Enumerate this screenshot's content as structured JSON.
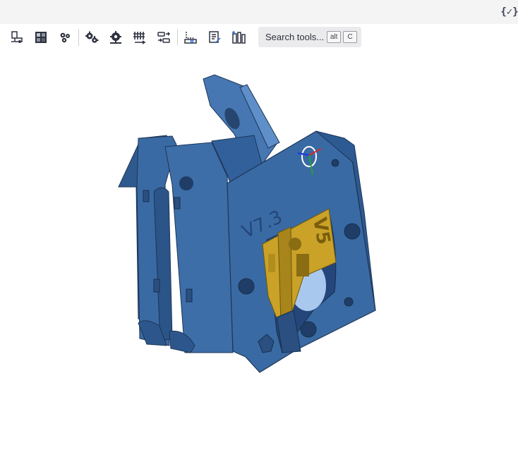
{
  "header": {
    "fullscreen_icon": "code-check-icon",
    "fullscreen_glyph": "{✓}"
  },
  "toolbar": {
    "tools": [
      {
        "name": "sketch-tool-icon"
      },
      {
        "name": "part-studio-tool-icon"
      },
      {
        "name": "assembly-tool-icon"
      },
      {
        "name": "gear-tool-icon"
      },
      {
        "name": "gear-settings-tool-icon"
      },
      {
        "name": "pattern-tool-icon"
      },
      {
        "name": "transform-tool-icon"
      },
      {
        "name": "drawing-tool-icon"
      },
      {
        "name": "document-edit-tool-icon"
      },
      {
        "name": "library-tool-icon"
      }
    ],
    "search": {
      "label": "Search tools...",
      "shortcut_keys": [
        "alt",
        "C"
      ]
    }
  },
  "viewport": {
    "model_label_main": "V7.3",
    "model_label_insert": "V5",
    "colors": {
      "body": "#3a6aa3",
      "body_dark": "#284d7c",
      "body_light": "#4a7cb8",
      "insert": "#c9a227",
      "triad_x": "#d9262c",
      "triad_y": "#23a23a",
      "triad_z": "#1f3fd6"
    }
  }
}
